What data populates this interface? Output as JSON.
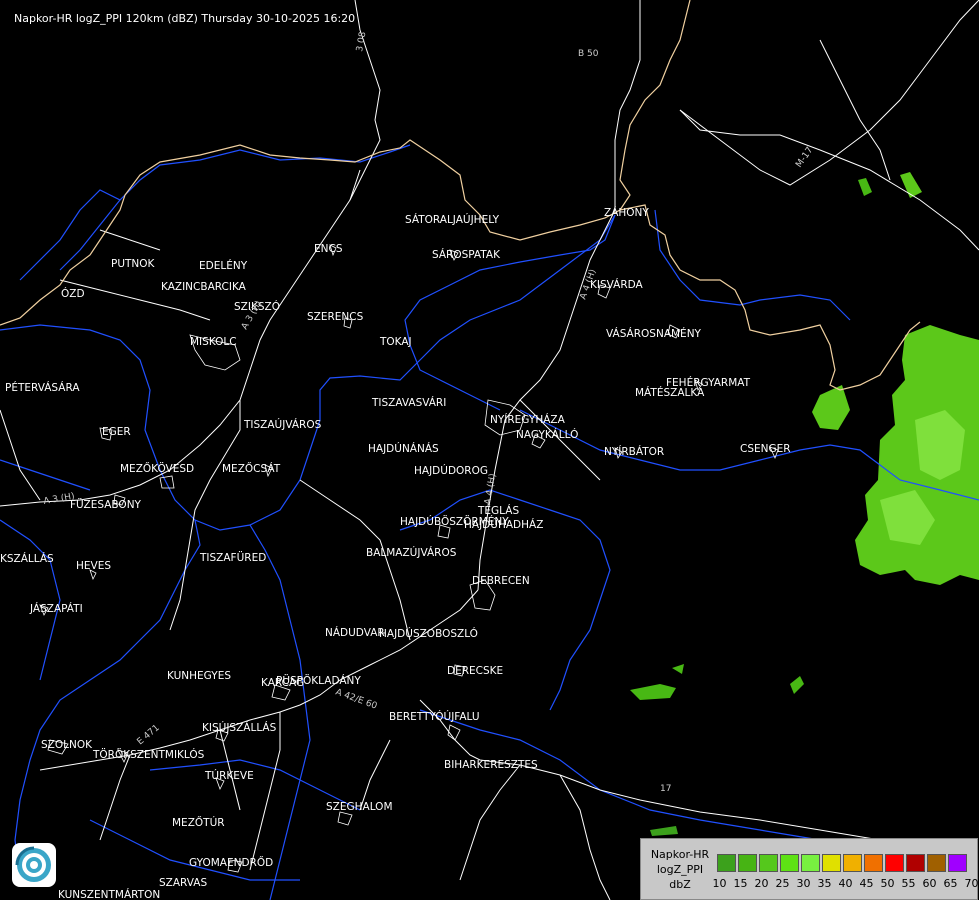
{
  "title": "Napkor-HR logZ_PPI 120km (dBZ) Thursday 30-10-2025 16:20",
  "cities": [
    {
      "name": "SÁTORALJAÚJHELY"
    },
    {
      "name": "SÁROSPATAK"
    },
    {
      "name": "ZÁHONY"
    },
    {
      "name": "KISVÁRDA"
    },
    {
      "name": "PUTNOK"
    },
    {
      "name": "EDELÉNY"
    },
    {
      "name": "ENCS"
    },
    {
      "name": "KAZINCBARCIKA"
    },
    {
      "name": "ÓZD"
    },
    {
      "name": "SZIKSZÓ"
    },
    {
      "name": "SZERENCS"
    },
    {
      "name": "MISKOLC"
    },
    {
      "name": "TOKAJ"
    },
    {
      "name": "VÁSÁROSNAMÉNY"
    },
    {
      "name": "PÉTERVÁSÁRA"
    },
    {
      "name": "FEHÉRGYARMAT"
    },
    {
      "name": "MÁTÉSZALKA"
    },
    {
      "name": "TISZAVASVÁRI"
    },
    {
      "name": "NYÍREGYHÁZA"
    },
    {
      "name": "EGER"
    },
    {
      "name": "TISZAÚJVÁROS"
    },
    {
      "name": "NAGYKÁLLÓ"
    },
    {
      "name": "HAJDÚNÁNÁS"
    },
    {
      "name": "NYÍRBÁTOR"
    },
    {
      "name": "CSENGER"
    },
    {
      "name": "MEZŐKÖVESD"
    },
    {
      "name": "MEZŐCSÁT"
    },
    {
      "name": "HAJDÚDOROG"
    },
    {
      "name": "FÜZESABONY"
    },
    {
      "name": "TÉGLÁS"
    },
    {
      "name": "HAJDÚBÖSZÖRMÉNY"
    },
    {
      "name": "HAJDÚHADHÁZ"
    },
    {
      "name": "BALMAZÚJVÁROS"
    },
    {
      "name": "TISZAFÜRED"
    },
    {
      "name": "KSZÁLLÁS"
    },
    {
      "name": "HEVES"
    },
    {
      "name": "DEBRECEN"
    },
    {
      "name": "JÁSZAPÁTI"
    },
    {
      "name": "NÁDUDVAR"
    },
    {
      "name": "HAJDÚSZOBOSZLÓ"
    },
    {
      "name": "KUNHEGYES"
    },
    {
      "name": "KARCAG"
    },
    {
      "name": "PÜSPÖKLADÁNY"
    },
    {
      "name": "DERECSKE"
    },
    {
      "name": "BERETTYÓÚJFALU"
    },
    {
      "name": "KISÚJSZÁLLÁS"
    },
    {
      "name": "SZOLNOK"
    },
    {
      "name": "TÖRÖKSZENTMIKLÓS"
    },
    {
      "name": "BIHARKERESZTES"
    },
    {
      "name": "TÚRKEVE"
    },
    {
      "name": "SZEGHALOM"
    },
    {
      "name": "MEZŐTÚR"
    },
    {
      "name": "GYOMAENDRŐD"
    },
    {
      "name": "SZARVAS"
    },
    {
      "name": "KUNSZENTMÁRTON"
    }
  ],
  "road_labels": [
    {
      "name": "3 08"
    },
    {
      "name": "B 50"
    },
    {
      "name": "M-17"
    },
    {
      "name": "A 3 (H)"
    },
    {
      "name": "A 3 (H)"
    },
    {
      "name": "A 4 (H)"
    },
    {
      "name": "A 4 (H)"
    },
    {
      "name": "A 42/E 60"
    },
    {
      "name": "E 471"
    },
    {
      "name": "17"
    }
  ],
  "legend": {
    "line1": "Napkor-HR",
    "line2": "logZ_PPI",
    "line3": "dbZ",
    "values": [
      "10",
      "15",
      "20",
      "25",
      "30",
      "35",
      "40",
      "45",
      "50",
      "55",
      "60",
      "65",
      "70"
    ],
    "colors": [
      "#3ca11c",
      "#47b414",
      "#55c81c",
      "#5ee214",
      "#78f040",
      "#e0e000",
      "#f0b000",
      "#f07000",
      "#ff0000",
      "#b00000",
      "#a06000",
      "#a000ff",
      "#a0a0ff"
    ]
  },
  "colors": {
    "border": "#f0d0a0",
    "river": "#2050ff",
    "road": "#ffffff",
    "echo_light": "#60d020",
    "echo_mid": "#80e040"
  }
}
